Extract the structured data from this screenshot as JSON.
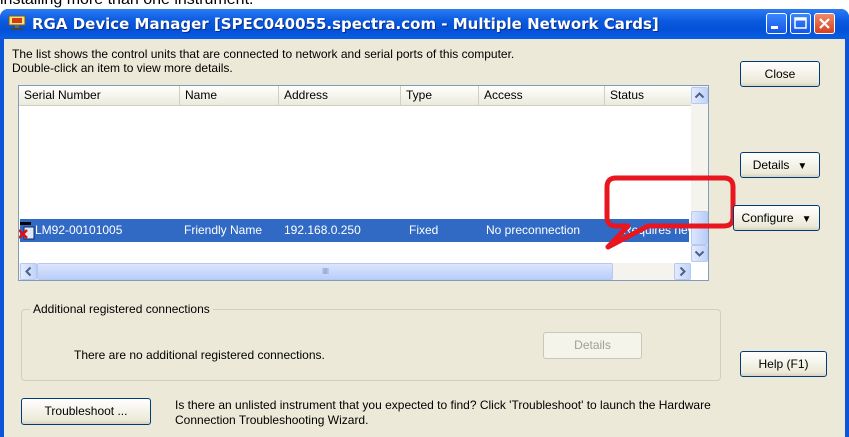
{
  "document": {
    "partial_text_above": "installing more than one instrument."
  },
  "window": {
    "title": "RGA Device Manager [SPEC040055.spectra.com - Multiple Network Cards]",
    "app_icon": "network-device-icon",
    "controls": {
      "minimize": "minimize-icon",
      "maximize": "maximize-icon",
      "close": "close-icon"
    }
  },
  "info": {
    "line1": "The list shows the control units that are connected to network and serial ports of this computer.",
    "line2": "Double-click an item to view more details."
  },
  "buttons": {
    "close": "Close",
    "details": "Details",
    "configure": "Configure",
    "help": "Help (F1)",
    "troubleshoot": "Troubleshoot ...",
    "registered_details": "Details"
  },
  "list": {
    "columns": [
      "Serial Number",
      "Name",
      "Address",
      "Type",
      "Access",
      "Status"
    ],
    "rows": [
      {
        "serial": "LM92-00101005",
        "name": "Friendly Name",
        "address": "192.168.0.250",
        "type": "Fixed",
        "access": "No preconnection",
        "status": "Requires new",
        "selected": true,
        "icon": "device-error-icon"
      }
    ]
  },
  "registered": {
    "group_title": "Additional registered connections",
    "empty_text": "There are no additional registered connections."
  },
  "troubleshoot": {
    "line1": "Is there an unlisted instrument that you expected to find?  Click 'Troubleshoot' to launch the Hardware",
    "line2": "Connection Troubleshooting Wizard."
  },
  "colors": {
    "titlebar": "#0a5ae0",
    "selection": "#316ac5",
    "dialog": "#ece9d8",
    "callout": "#e8161e"
  }
}
